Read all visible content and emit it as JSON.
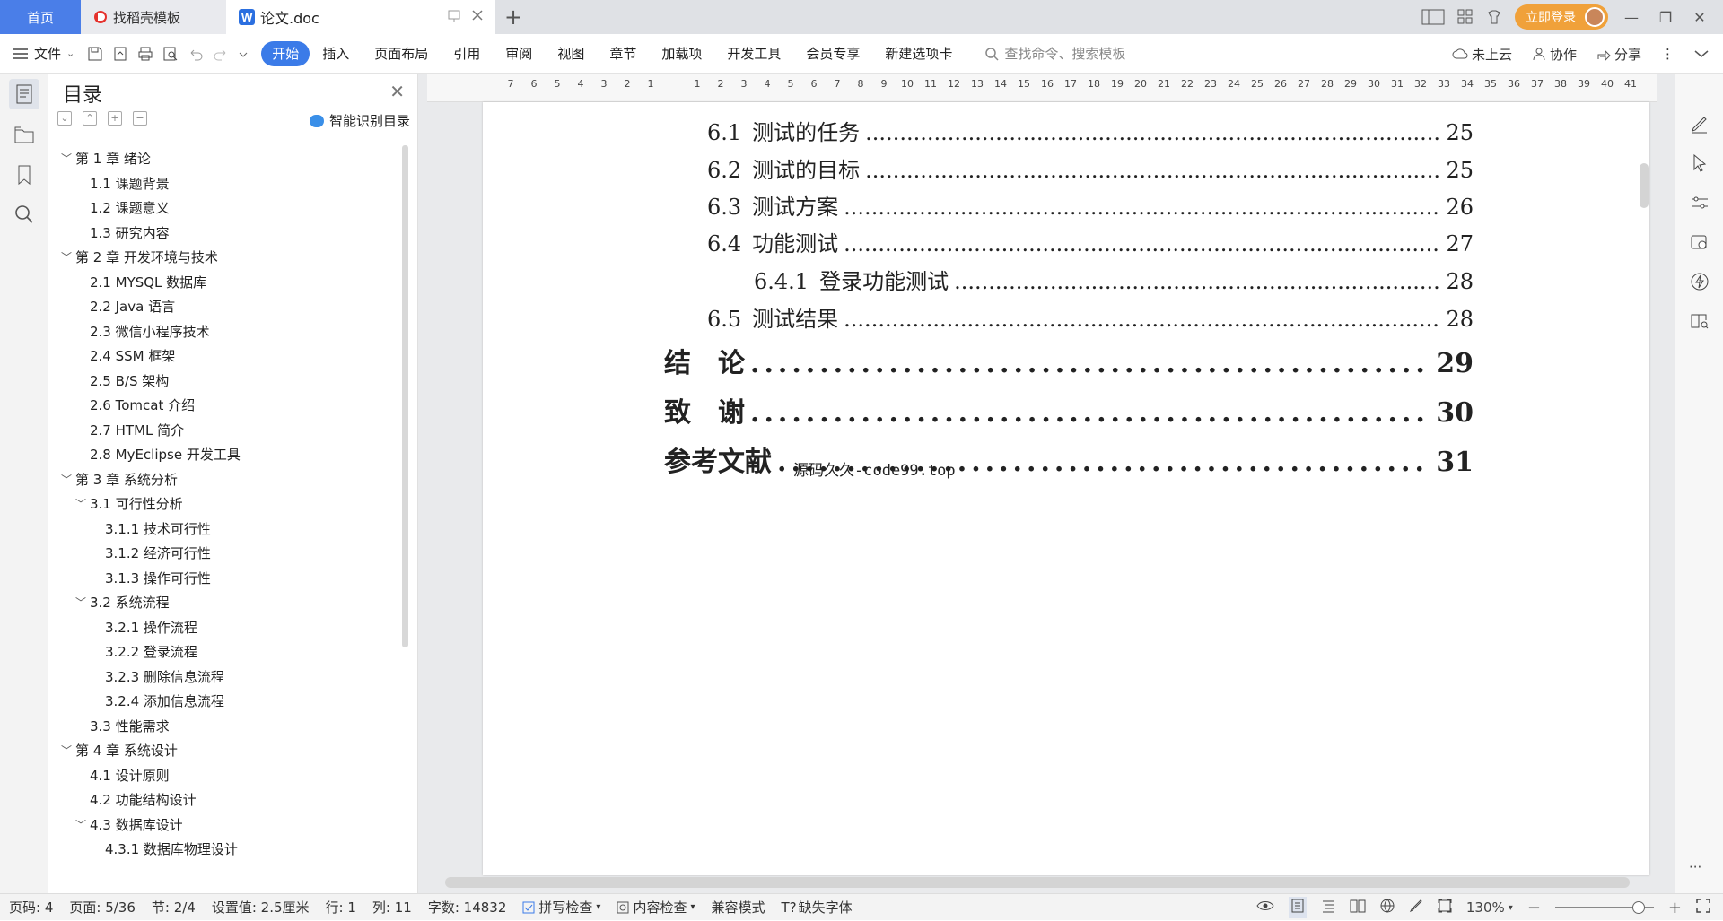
{
  "tabs": {
    "home": "首页",
    "template": "找稻壳模板",
    "doc": "论文.doc"
  },
  "window": {
    "login": "立即登录"
  },
  "ribbon": {
    "file": "文件",
    "tabs": [
      "开始",
      "插入",
      "页面布局",
      "引用",
      "审阅",
      "视图",
      "章节",
      "加载项",
      "开发工具",
      "会员专享",
      "新建选项卡"
    ],
    "search_placeholder": "查找命令、搜索模板",
    "cloud": "未上云",
    "collab": "协作",
    "share": "分享"
  },
  "toc_panel": {
    "title": "目录",
    "smart": "智能识别目录",
    "items": [
      {
        "text": "第 1 章  绪论",
        "level": 1,
        "expanded": true
      },
      {
        "text": "1.1  课题背景",
        "level": 2
      },
      {
        "text": "1.2  课题意义",
        "level": 2
      },
      {
        "text": "1.3  研究内容",
        "level": 2
      },
      {
        "text": "第 2 章  开发环境与技术",
        "level": 1,
        "expanded": true
      },
      {
        "text": "2.1  MYSQL 数据库",
        "level": 2
      },
      {
        "text": "2.2 Java 语言",
        "level": 2
      },
      {
        "text": "2.3  微信小程序技术",
        "level": 2
      },
      {
        "text": "2.4 SSM 框架",
        "level": 2
      },
      {
        "text": "2.5 B/S 架构",
        "level": 2
      },
      {
        "text": "2.6 Tomcat  介绍",
        "level": 2
      },
      {
        "text": "2.7 HTML 简介",
        "level": 2
      },
      {
        "text": "2.8 MyEclipse 开发工具",
        "level": 2
      },
      {
        "text": "第 3 章  系统分析",
        "level": 1,
        "expanded": true
      },
      {
        "text": "3.1  可行性分析",
        "level": 2,
        "expanded": true
      },
      {
        "text": "3.1.1  技术可行性",
        "level": 3
      },
      {
        "text": "3.1.2  经济可行性",
        "level": 3
      },
      {
        "text": "3.1.3  操作可行性",
        "level": 3
      },
      {
        "text": "3.2  系统流程",
        "level": 2,
        "expanded": true
      },
      {
        "text": "3.2.1  操作流程",
        "level": 3
      },
      {
        "text": "3.2.2  登录流程",
        "level": 3
      },
      {
        "text": "3.2.3  删除信息流程",
        "level": 3
      },
      {
        "text": "3.2.4  添加信息流程",
        "level": 3
      },
      {
        "text": "3.3  性能需求",
        "level": 2
      },
      {
        "text": "第 4 章  系统设计",
        "level": 1,
        "expanded": true
      },
      {
        "text": "4.1  设计原则",
        "level": 2
      },
      {
        "text": "4.2  功能结构设计",
        "level": 2
      },
      {
        "text": "4.3  数据库设计",
        "level": 2,
        "expanded": true
      },
      {
        "text": "4.3.1  数据库物理设计",
        "level": 3
      }
    ]
  },
  "ruler": {
    "numbers": [
      "7",
      "6",
      "5",
      "4",
      "3",
      "2",
      "1",
      "",
      "1",
      "2",
      "3",
      "4",
      "5",
      "6",
      "7",
      "8",
      "9",
      "10",
      "11",
      "12",
      "13",
      "14",
      "15",
      "16",
      "17",
      "18",
      "19",
      "20",
      "21",
      "22",
      "23",
      "24",
      "25",
      "26",
      "27",
      "28",
      "29",
      "30",
      "31",
      "32",
      "33",
      "34",
      "35",
      "36",
      "37",
      "38",
      "39",
      "40",
      "41"
    ]
  },
  "document": {
    "lines": [
      {
        "num": "6.1",
        "title": "测试的任务",
        "page": "25",
        "style": "l2"
      },
      {
        "num": "6.2",
        "title": "测试的目标",
        "page": "25",
        "style": "l2"
      },
      {
        "num": "6.3",
        "title": "测试方案",
        "page": "26",
        "style": "l2"
      },
      {
        "num": "6.4",
        "title": "功能测试",
        "page": "27",
        "style": "l2"
      },
      {
        "num": "6.4.1",
        "title": "登录功能测试",
        "page": "28",
        "style": "l3"
      },
      {
        "num": "6.5",
        "title": "测试结果",
        "page": "28",
        "style": "l2"
      },
      {
        "num": "",
        "title": "结　论",
        "page": "29",
        "style": "l1"
      },
      {
        "num": "",
        "title": "致　谢",
        "page": "30",
        "style": "l1"
      },
      {
        "num": "",
        "title": "参考文献",
        "page": "31",
        "style": "l1"
      }
    ],
    "watermark": "源码久久-code99.top"
  },
  "status": {
    "page_code": "页码: 4",
    "page": "页面: 5/36",
    "section": "节: 2/4",
    "setting": "设置值: 2.5厘米",
    "row": "行: 1",
    "col": "列: 11",
    "words": "字数: 14832",
    "spell": "拼写检查",
    "content_check": "内容检查",
    "compat": "兼容模式",
    "missing_font": "缺失字体",
    "zoom": "130%"
  },
  "colors": {
    "accent": "#3b7be8",
    "login": "#f0a13a"
  }
}
